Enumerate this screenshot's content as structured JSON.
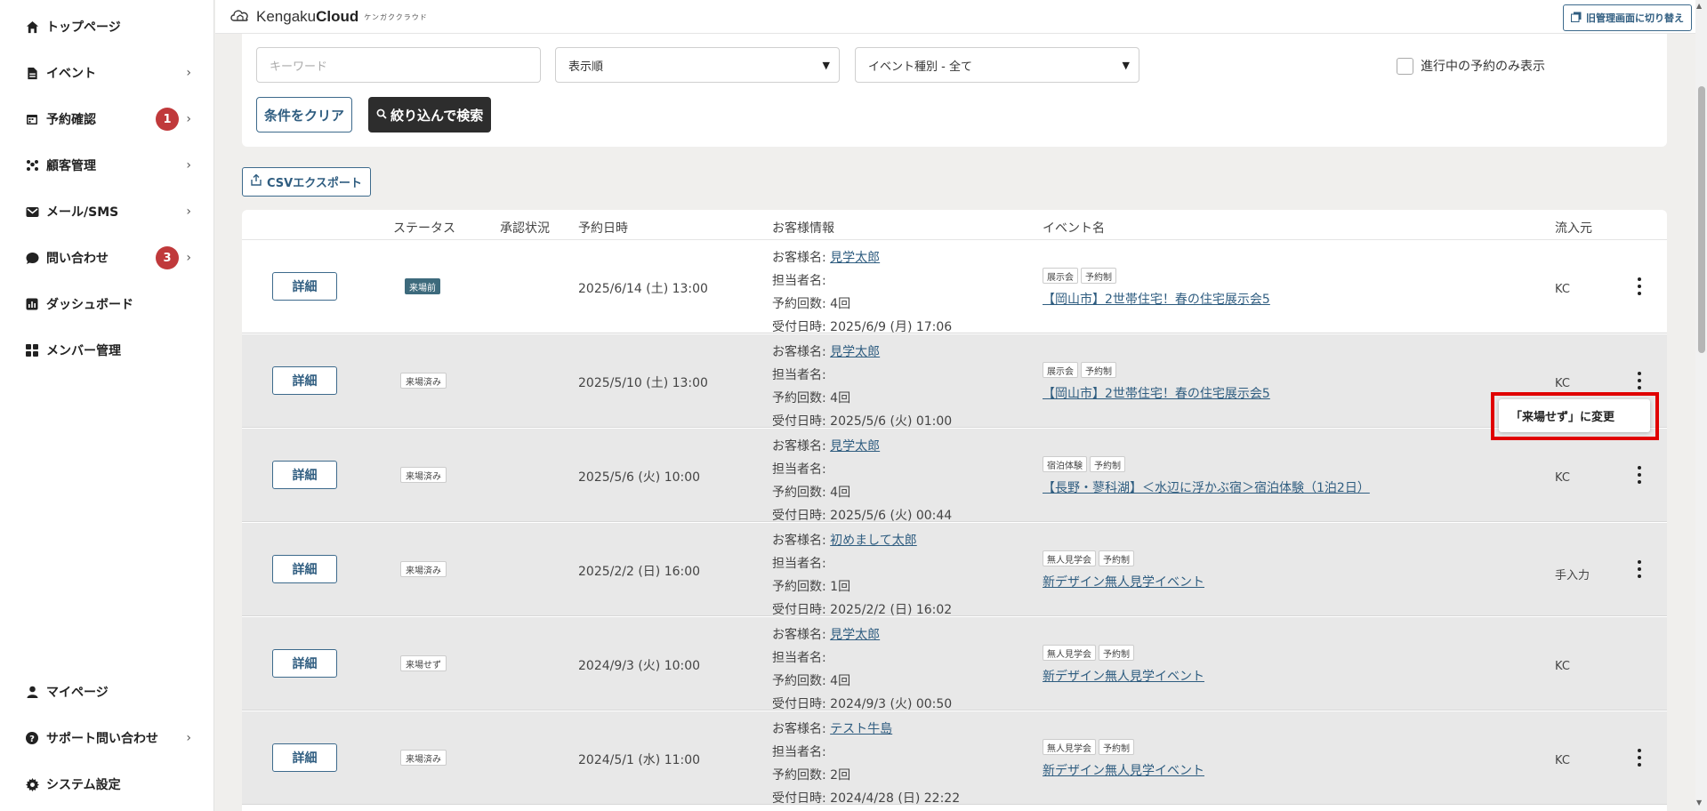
{
  "sidebar": {
    "items": [
      {
        "label": "トップページ",
        "icon": "home-icon"
      },
      {
        "label": "イベント",
        "icon": "document-icon",
        "chevron": "›"
      },
      {
        "label": "予約確認",
        "icon": "calendar-icon",
        "chevron": "›",
        "badge": "1"
      },
      {
        "label": "顧客管理",
        "icon": "users-icon",
        "chevron": "›"
      },
      {
        "label": "メール/SMS",
        "icon": "mail-icon",
        "chevron": "›"
      },
      {
        "label": "問い合わせ",
        "icon": "chat-icon",
        "chevron": "›",
        "badge": "3"
      },
      {
        "label": "ダッシュボード",
        "icon": "chart-icon"
      },
      {
        "label": "メンバー管理",
        "icon": "grid-icon"
      }
    ],
    "bottom_items": [
      {
        "label": "マイページ",
        "icon": "person-icon"
      },
      {
        "label": "サポート問い合わせ",
        "icon": "help-icon",
        "chevron": "›"
      },
      {
        "label": "システム設定",
        "icon": "gear-icon"
      }
    ]
  },
  "header": {
    "brand_light": "Kengaku",
    "brand_bold": "Cloud",
    "brand_kana": "ケンガククラウド",
    "switch_label": "旧管理画面に切り替え"
  },
  "search": {
    "keyword_placeholder": "キーワード",
    "sort_value": "表示順",
    "event_type_value": "イベント種別 - 全て",
    "active_only_label": "進行中の予約のみ表示",
    "clear_label": "条件をクリア",
    "search_label": "絞り込んで検索"
  },
  "csv_label": "CSVエクスポート",
  "table": {
    "headers": {
      "status": "ステータス",
      "approval": "承認状況",
      "date": "予約日時",
      "customer": "お客様情報",
      "event": "イベント名",
      "source": "流入元"
    },
    "detail_label": "詳細",
    "customer_name_label": "お客様名:",
    "staff_label": "担当者名:",
    "rows": [
      {
        "status": "来場前",
        "date": "2025/6/14 (土) 13:00",
        "customer": "見学太郎",
        "count": "予約回数: 4回",
        "received": "受付日時: 2025/6/9 (月) 17:06",
        "tags": [
          "展示会",
          "予約制"
        ],
        "event": "【岡山市】2世帯住宅！春の住宅展示会5",
        "source": "KC"
      },
      {
        "status": "来場済み",
        "date": "2025/5/10 (土) 13:00",
        "customer": "見学太郎",
        "count": "予約回数: 4回",
        "received": "受付日時: 2025/5/6 (火) 01:00",
        "tags": [
          "展示会",
          "予約制"
        ],
        "event": "【岡山市】2世帯住宅！春の住宅展示会5",
        "source": "KC"
      },
      {
        "status": "来場済み",
        "date": "2025/5/6 (火) 10:00",
        "customer": "見学太郎",
        "count": "予約回数: 4回",
        "received": "受付日時: 2025/5/6 (火) 00:44",
        "tags": [
          "宿泊体験",
          "予約制"
        ],
        "event": "【長野・蓼科湖】＜水辺に浮かぶ宿＞宿泊体験（1泊2日）",
        "source": "KC"
      },
      {
        "status": "来場済み",
        "date": "2025/2/2 (日) 16:00",
        "customer": "初めまして太郎",
        "count": "予約回数: 1回",
        "received": "受付日時: 2025/2/2 (日) 16:02",
        "tags": [
          "無人見学会",
          "予約制"
        ],
        "event": "新デザイン無人見学イベント",
        "source": "手入力"
      },
      {
        "status": "来場せず",
        "date": "2024/9/3 (火) 10:00",
        "customer": "見学太郎",
        "count": "予約回数: 4回",
        "received": "受付日時: 2024/9/3 (火) 00:50",
        "tags": [
          "無人見学会",
          "予約制"
        ],
        "event": "新デザイン無人見学イベント",
        "source": "KC"
      },
      {
        "status": "来場済み",
        "date": "2024/5/1 (水) 11:00",
        "customer": "テスト牛島",
        "count": "予約回数: 2回",
        "received": "受付日時: 2024/4/28 (日) 22:22",
        "tags": [
          "無人見学会",
          "予約制"
        ],
        "event": "新デザイン無人見学イベント",
        "source": "KC"
      }
    ]
  },
  "popup": {
    "label": "「来場せず」に変更"
  },
  "colors": {
    "accent": "#2f5d80",
    "badge": "#c0393b",
    "highlight": "#e00000",
    "dark_button": "#2d2d2d"
  }
}
